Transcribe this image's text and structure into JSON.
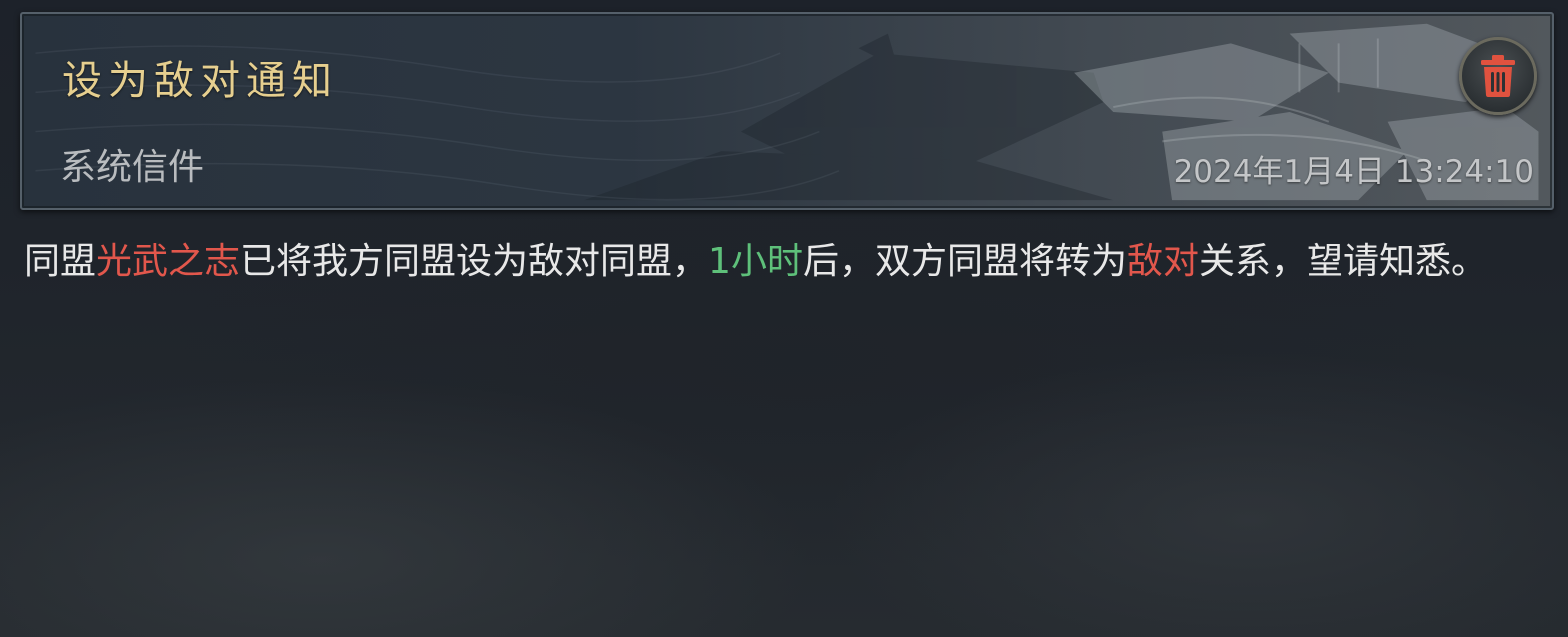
{
  "mail": {
    "title": "设为敌对通知",
    "sender": "系统信件",
    "timestamp": "2024年1月4日 13:24:10",
    "delete_icon": "trash-icon",
    "body": {
      "seg1": "同盟",
      "alliance_name": "光武之志",
      "seg2": "已将我方同盟设为敌对同盟，",
      "countdown": "1小时",
      "seg3": "后，双方同盟将转为",
      "relation": "敌对",
      "seg4": "关系，望请知悉。"
    }
  },
  "colors": {
    "title": "#e6cf8f",
    "highlight_red": "#e2574c",
    "highlight_green": "#5ec07a",
    "delete_icon": "#e0523f"
  }
}
